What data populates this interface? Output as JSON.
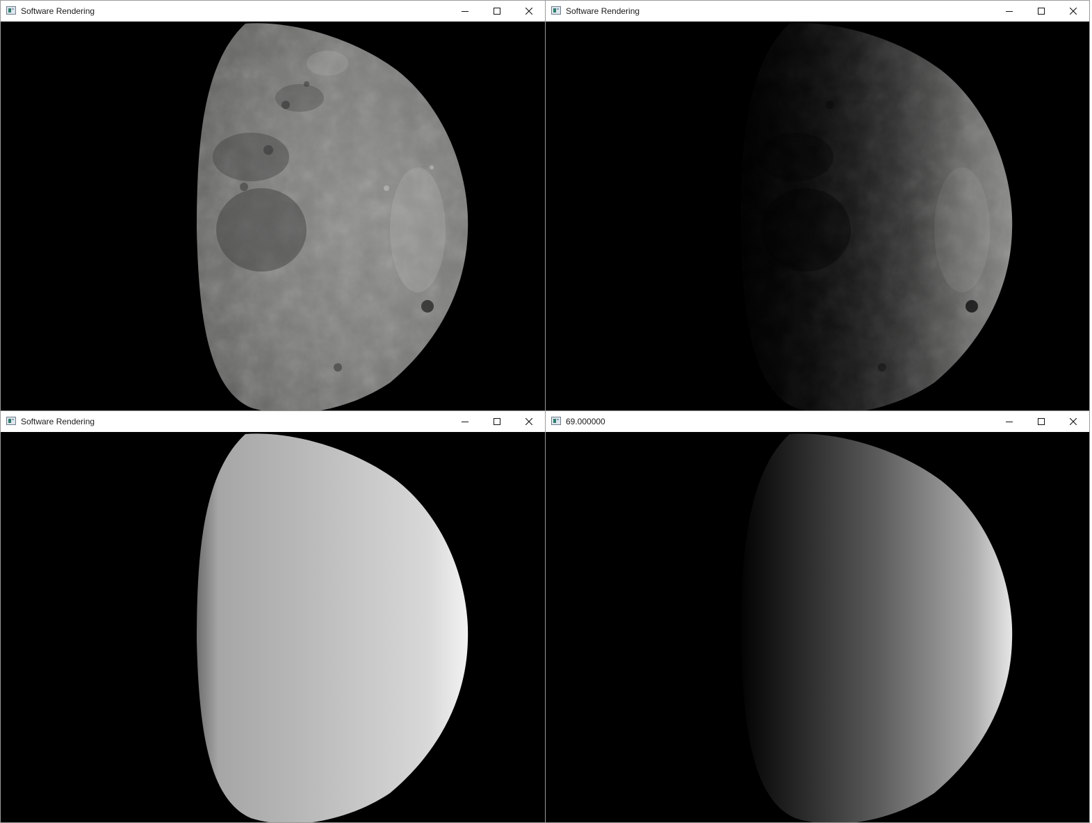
{
  "windows": [
    {
      "title": "Software Rendering",
      "render": "textured moon, full lighting",
      "controls": {
        "minimize_icon": "minimize-icon",
        "maximize_icon": "maximize-icon",
        "close_icon": "close-icon"
      }
    },
    {
      "title": "Software Rendering",
      "render": "textured moon, shaded lighting",
      "controls": {
        "minimize_icon": "minimize-icon",
        "maximize_icon": "maximize-icon",
        "close_icon": "close-icon"
      }
    },
    {
      "title": "Software Rendering",
      "render": "untextured sphere, bright gradient",
      "controls": {
        "minimize_icon": "minimize-icon",
        "maximize_icon": "maximize-icon",
        "close_icon": "close-icon"
      }
    },
    {
      "title": "69.000000",
      "render": "untextured sphere, dark gradient",
      "controls": {
        "minimize_icon": "minimize-icon",
        "maximize_icon": "maximize-icon",
        "close_icon": "close-icon"
      }
    }
  ],
  "colors": {
    "viewport_background": "#000000",
    "titlebar_background": "#ffffff",
    "title_text": "#1a1a1a",
    "window_border": "#9a9a9a"
  }
}
